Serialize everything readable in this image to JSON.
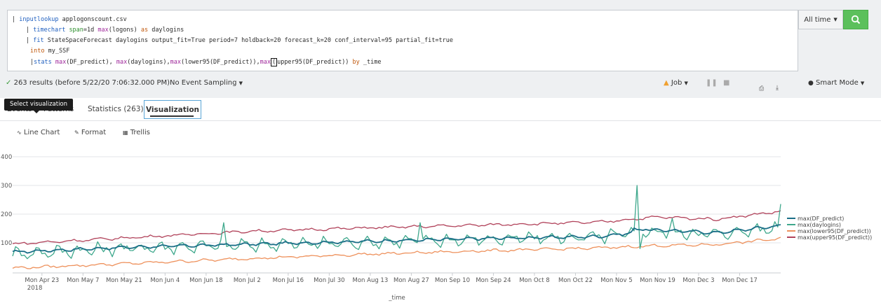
{
  "search": {
    "lines": [
      {
        "parts": [
          {
            "t": "| ",
            "c": ""
          },
          {
            "t": "inputlookup",
            "c": "kw-blue"
          },
          {
            "t": " applogonscount.csv",
            "c": ""
          }
        ]
      },
      {
        "parts": [
          {
            "t": "| ",
            "c": ""
          },
          {
            "t": "timechart",
            "c": "kw-blue"
          },
          {
            "t": " ",
            "c": ""
          },
          {
            "t": "span",
            "c": "kw-green"
          },
          {
            "t": "=1d ",
            "c": ""
          },
          {
            "t": "max",
            "c": "kw-purple"
          },
          {
            "t": "(logons) ",
            "c": ""
          },
          {
            "t": "as",
            "c": "kw-orange"
          },
          {
            "t": " daylogins",
            "c": ""
          }
        ]
      },
      {
        "parts": [
          {
            "t": "| ",
            "c": ""
          },
          {
            "t": "fit",
            "c": "kw-blue"
          },
          {
            "t": " StateSpaceForecast daylogins output_fit=True period=7 holdback=20 forecast_k=20 conf_interval=95 partial_fit=true",
            "c": ""
          }
        ]
      },
      {
        "parts": [
          {
            "t": "into",
            "c": "kw-orange"
          },
          {
            "t": " my_SSF",
            "c": ""
          }
        ]
      },
      {
        "parts": [
          {
            "t": "|",
            "c": ""
          },
          {
            "t": "stats",
            "c": "kw-blue"
          },
          {
            "t": " ",
            "c": ""
          },
          {
            "t": "max",
            "c": "kw-purple"
          },
          {
            "t": "(DF_predict), ",
            "c": ""
          },
          {
            "t": "max",
            "c": "kw-purple"
          },
          {
            "t": "(daylogins),",
            "c": ""
          },
          {
            "t": "max",
            "c": "kw-purple"
          },
          {
            "t": "(lower95(DF_predict)),",
            "c": ""
          },
          {
            "t": "max",
            "c": "kw-purple"
          },
          {
            "t": "(",
            "c": "cursor"
          },
          {
            "t": "upper95(DF_predict)) ",
            "c": ""
          },
          {
            "t": "by",
            "c": "kw-orange"
          },
          {
            "t": " _time",
            "c": ""
          }
        ]
      }
    ]
  },
  "timepicker": {
    "label": "All time"
  },
  "status": {
    "results": "263 results (before 5/22/20 7:06:32.000 PM)",
    "sampling": "No Event Sampling",
    "job": "Job",
    "mode": "Smart Mode"
  },
  "tabs": {
    "events": "Events",
    "patterns": "Patterns",
    "statistics": "Statistics (263)",
    "visualization": "Visualization"
  },
  "tooltip": "Select visualization",
  "toolbar": {
    "line_chart": "Line Chart",
    "format": "Format",
    "trellis": "Trellis"
  },
  "colors": {
    "predict": "#1a6e87",
    "daylogins": "#3ea88c",
    "lower95": "#ee915c",
    "upper95": "#b1425a",
    "search_button": "#5cc05c"
  },
  "chart_data": {
    "type": "line",
    "xlabel": "_time",
    "ylabel": "",
    "ylim": [
      0,
      400
    ],
    "yticks": [
      "100",
      "200",
      "300",
      "400"
    ],
    "x_tick_labels": [
      "Mon Apr 23",
      "Mon May 7",
      "Mon May 21",
      "Mon Jun 4",
      "Mon Jun 18",
      "Mon Jul 2",
      "Mon Jul 16",
      "Mon Jul 30",
      "Mon Aug 13",
      "Mon Aug 27",
      "Mon Sep 10",
      "Mon Sep 24",
      "Mon Oct 8",
      "Mon Oct 22",
      "Mon Nov 5",
      "Mon Nov 19",
      "Mon Dec 3",
      "Mon Dec 17"
    ],
    "x_year_label": "2018",
    "x_start": "2018-04-13",
    "days": 263,
    "series": [
      {
        "name": "max(DF_predict)",
        "trend": [
          [
            0,
            68
          ],
          [
            40,
            85
          ],
          [
            80,
            95
          ],
          [
            120,
            105
          ],
          [
            160,
            115
          ],
          [
            200,
            122
          ],
          [
            220,
            145
          ],
          [
            240,
            135
          ],
          [
            262,
            160
          ]
        ]
      },
      {
        "name": "max(daylogins)",
        "trend": [
          [
            0,
            62
          ],
          [
            40,
            82
          ],
          [
            80,
            92
          ],
          [
            120,
            102
          ],
          [
            160,
            112
          ],
          [
            200,
            120
          ],
          [
            220,
            140
          ],
          [
            240,
            130
          ],
          [
            262,
            155
          ]
        ],
        "spikes": [
          [
            72,
            170
          ],
          [
            139,
            170
          ],
          [
            213,
            300
          ],
          [
            225,
            185
          ],
          [
            262,
            235
          ]
        ]
      },
      {
        "name": "max(lower95(DF_predict))",
        "trend": [
          [
            0,
            12
          ],
          [
            40,
            28
          ],
          [
            80,
            45
          ],
          [
            120,
            60
          ],
          [
            160,
            72
          ],
          [
            200,
            82
          ],
          [
            220,
            90
          ],
          [
            240,
            94
          ],
          [
            262,
            115
          ]
        ]
      },
      {
        "name": "max(upper95(DF_predict))",
        "trend": [
          [
            0,
            96
          ],
          [
            40,
            118
          ],
          [
            80,
            140
          ],
          [
            120,
            152
          ],
          [
            160,
            162
          ],
          [
            200,
            172
          ],
          [
            220,
            190
          ],
          [
            240,
            182
          ],
          [
            262,
            210
          ]
        ]
      }
    ]
  }
}
